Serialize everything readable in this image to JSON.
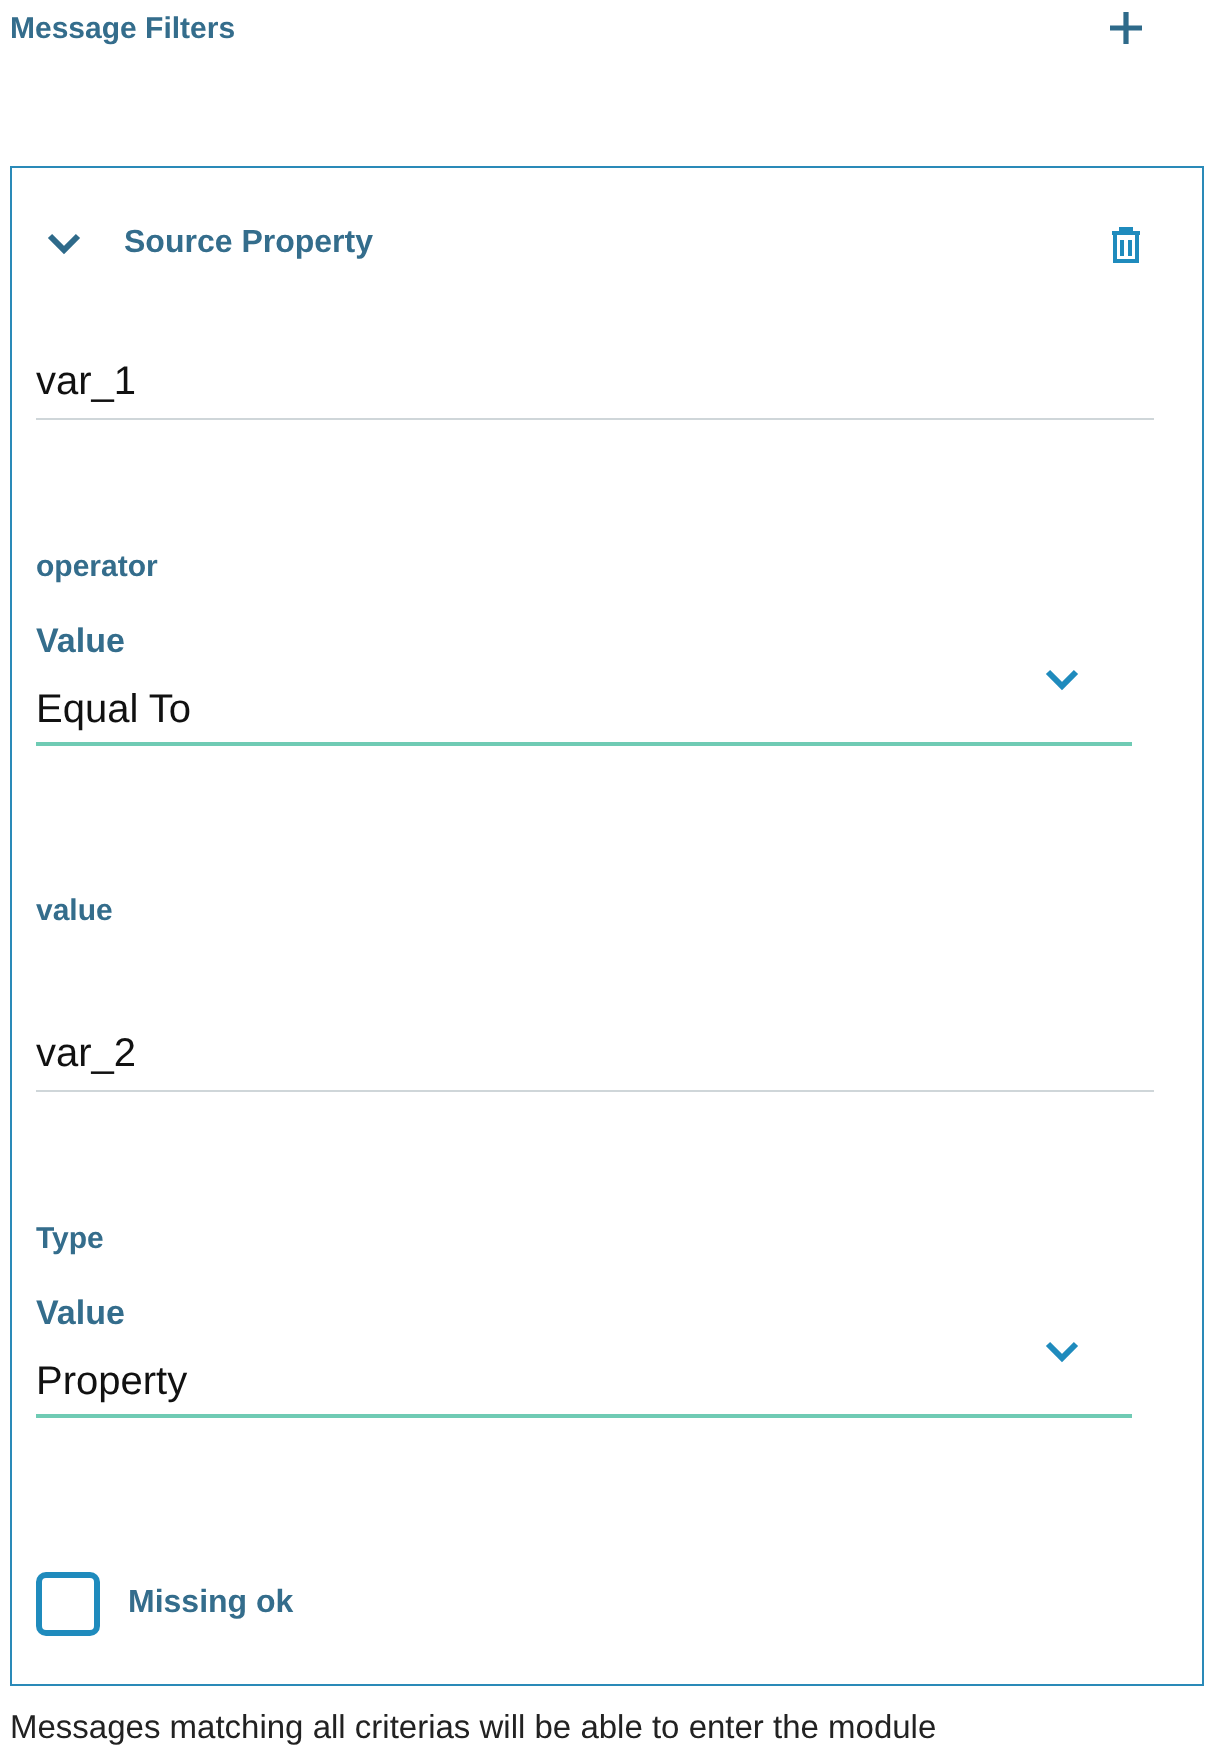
{
  "section": {
    "title": "Message Filters"
  },
  "filter": {
    "title": "Source Property",
    "expanded": true,
    "fields": [
      {
        "kind": "text",
        "value": "var_1"
      },
      {
        "kind": "select",
        "label": "operator",
        "floating_label": "Value",
        "value": "Equal To"
      },
      {
        "kind": "text",
        "label": "value",
        "value": "var_2"
      },
      {
        "kind": "select",
        "label": "Type",
        "floating_label": "Value",
        "value": "Property"
      },
      {
        "kind": "checkbox",
        "label": "Missing ok",
        "checked": false
      }
    ]
  },
  "hint": "Messages matching all criterias will be able to enter the module"
}
